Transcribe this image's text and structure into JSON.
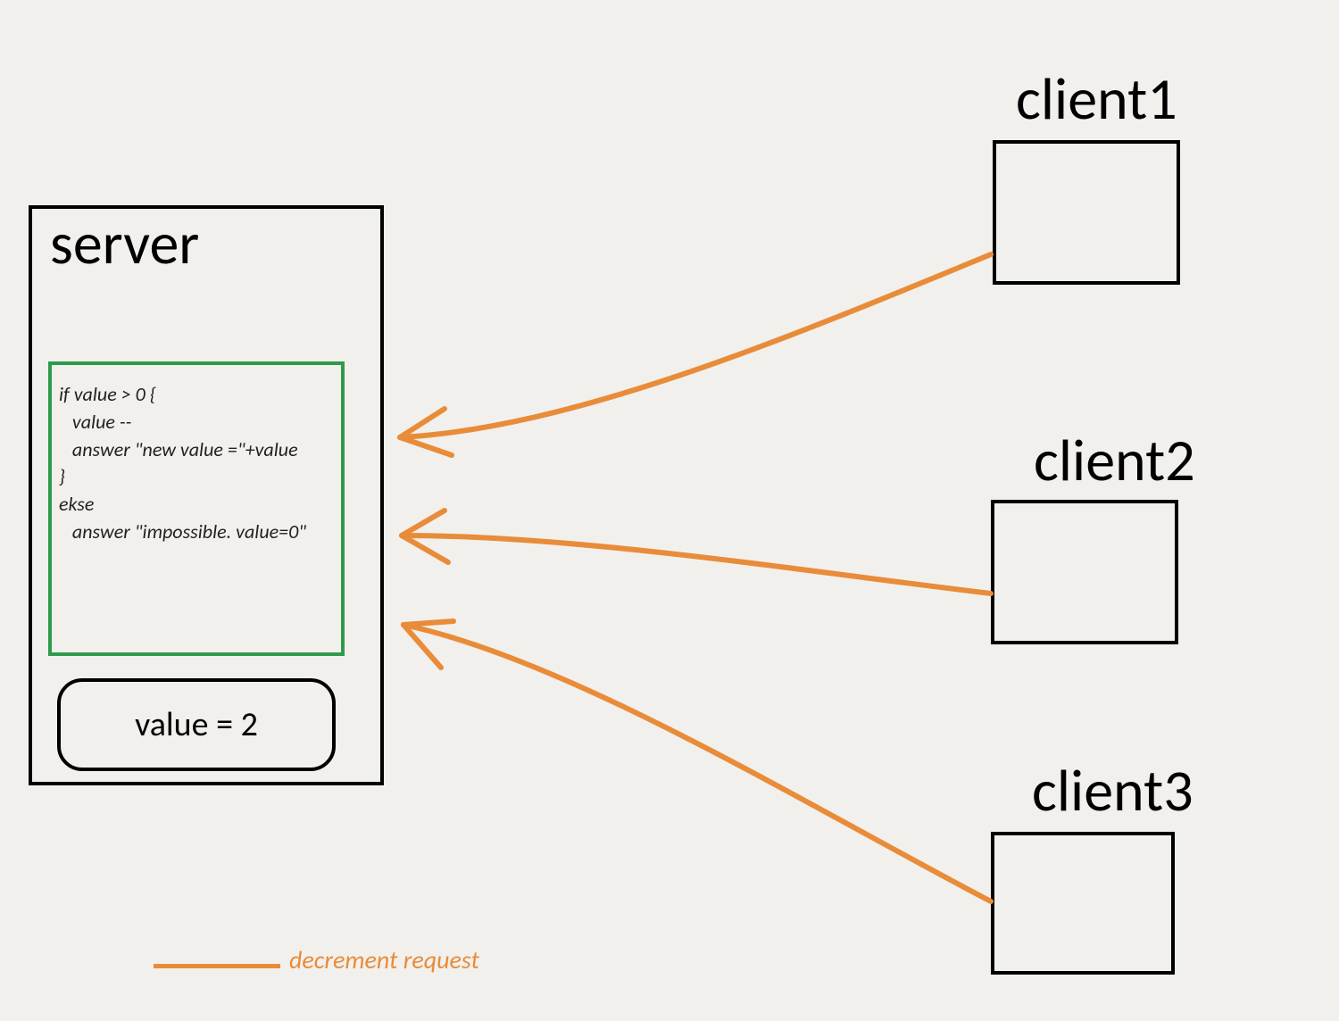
{
  "server": {
    "label": "server",
    "code": "if value > 0 {\n   value --\n   answer \"new value =\"+value\n}\nekse\n   answer \"impossible. value=0\"",
    "value_display": "value = 2"
  },
  "clients": {
    "c1": "client1",
    "c2": "client2",
    "c3": "client3"
  },
  "legend": {
    "label": "decrement request"
  },
  "colors": {
    "arrow": "#e88c3a",
    "code_border": "#2e9b4c"
  }
}
